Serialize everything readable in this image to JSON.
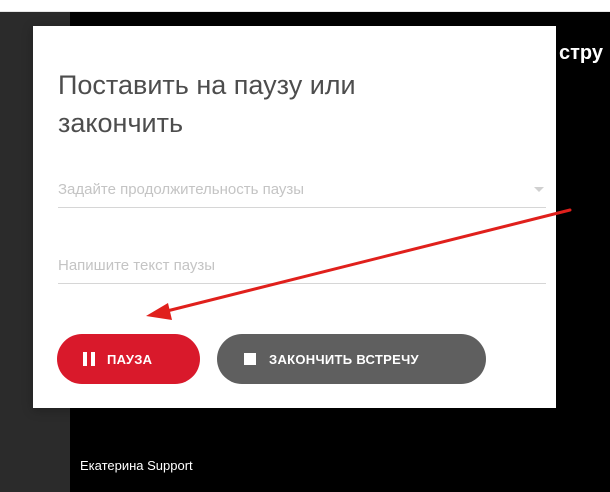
{
  "background": {
    "right_text": "стру",
    "participant_name": "Екатерина Support"
  },
  "dialog": {
    "title": "Поставить на паузу или закончить",
    "duration_field": {
      "placeholder": "Задайте продолжительность паузы"
    },
    "text_field": {
      "placeholder": "Напишите текст паузы"
    },
    "pause_button": {
      "label": "ПАУЗА",
      "icon": "pause-icon"
    },
    "end_button": {
      "label": "ЗАКОНЧИТЬ ВСТРЕЧУ",
      "icon": "stop-icon"
    }
  },
  "colors": {
    "pause_button": "#d9192b",
    "end_button": "#5f5f5f",
    "annotation_arrow": "#e0201c",
    "video_background": "#000000"
  }
}
